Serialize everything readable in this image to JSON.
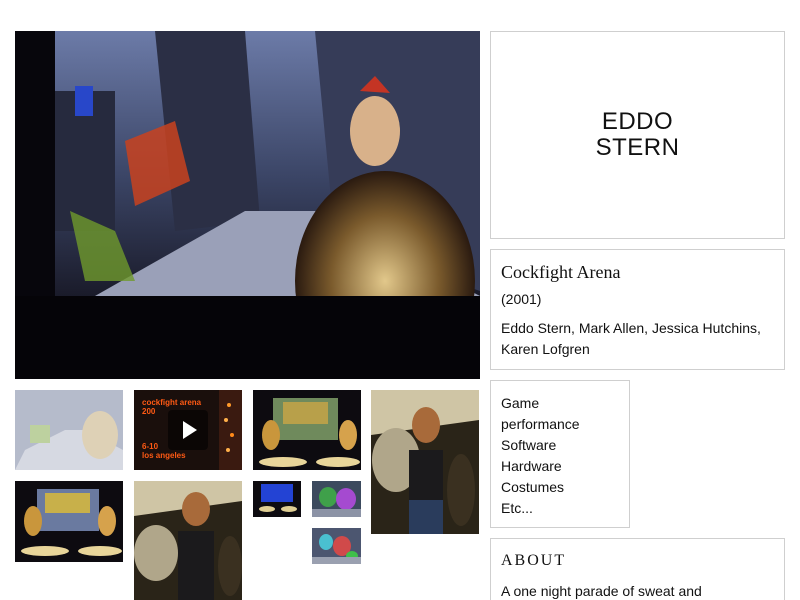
{
  "artist": {
    "name_line1": "EDDO",
    "name_line2": "STERN"
  },
  "work": {
    "title": "Cockfight Arena",
    "year": "(2001)",
    "credits": "Eddo Stern, Mark Allen, Jessica Hutchins, Karen Lofgren"
  },
  "tags": [
    "Game",
    "performance",
    "Software",
    "Hardware",
    "Costumes",
    "Etc..."
  ],
  "about": {
    "heading": "ABOUT",
    "text": "A one night parade of sweat and"
  },
  "video_thumb": {
    "line1": "cockfight arena",
    "line2": "200",
    "line3": "6-10",
    "line4": "los angeles"
  },
  "colors": {
    "border": "#cfcfcf",
    "text": "#111111",
    "video_text": "#ff5a14"
  }
}
